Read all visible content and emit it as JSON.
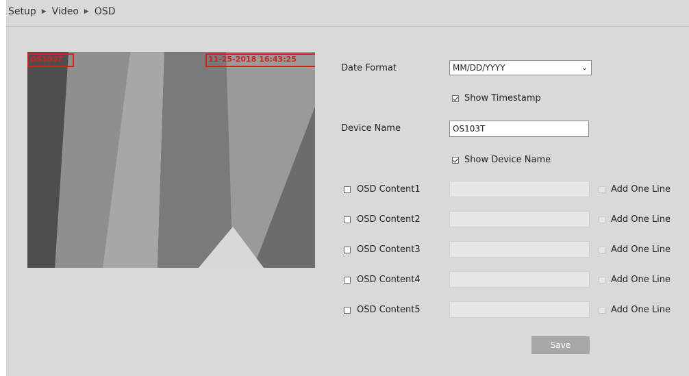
{
  "breadcrumb": {
    "items": [
      "Setup",
      "Video",
      "OSD"
    ]
  },
  "preview": {
    "osd_name": "OS103T",
    "osd_time": "11-25-2018 16:43:25"
  },
  "form": {
    "date_format_label": "Date Format",
    "date_format_value": "MM/DD/YYYY",
    "show_timestamp_label": "Show Timestamp",
    "show_timestamp_checked": true,
    "device_name_label": "Device Name",
    "device_name_value": "OS103T",
    "show_device_name_label": "Show Device Name",
    "show_device_name_checked": true,
    "osd_contents": [
      {
        "label": "OSD Content1",
        "add_line_label": "Add One Line"
      },
      {
        "label": "OSD Content2",
        "add_line_label": "Add One Line"
      },
      {
        "label": "OSD Content3",
        "add_line_label": "Add One Line"
      },
      {
        "label": "OSD Content4",
        "add_line_label": "Add One Line"
      },
      {
        "label": "OSD Content5",
        "add_line_label": "Add One Line"
      }
    ],
    "save_label": "Save"
  },
  "icons": {
    "separator": "triangle-right-icon",
    "dropdown": "chevron-down-icon"
  },
  "colors": {
    "osd_overlay": "#d62020",
    "panel_bg": "#d9d9d9",
    "save_bg": "#a8a8a8"
  }
}
